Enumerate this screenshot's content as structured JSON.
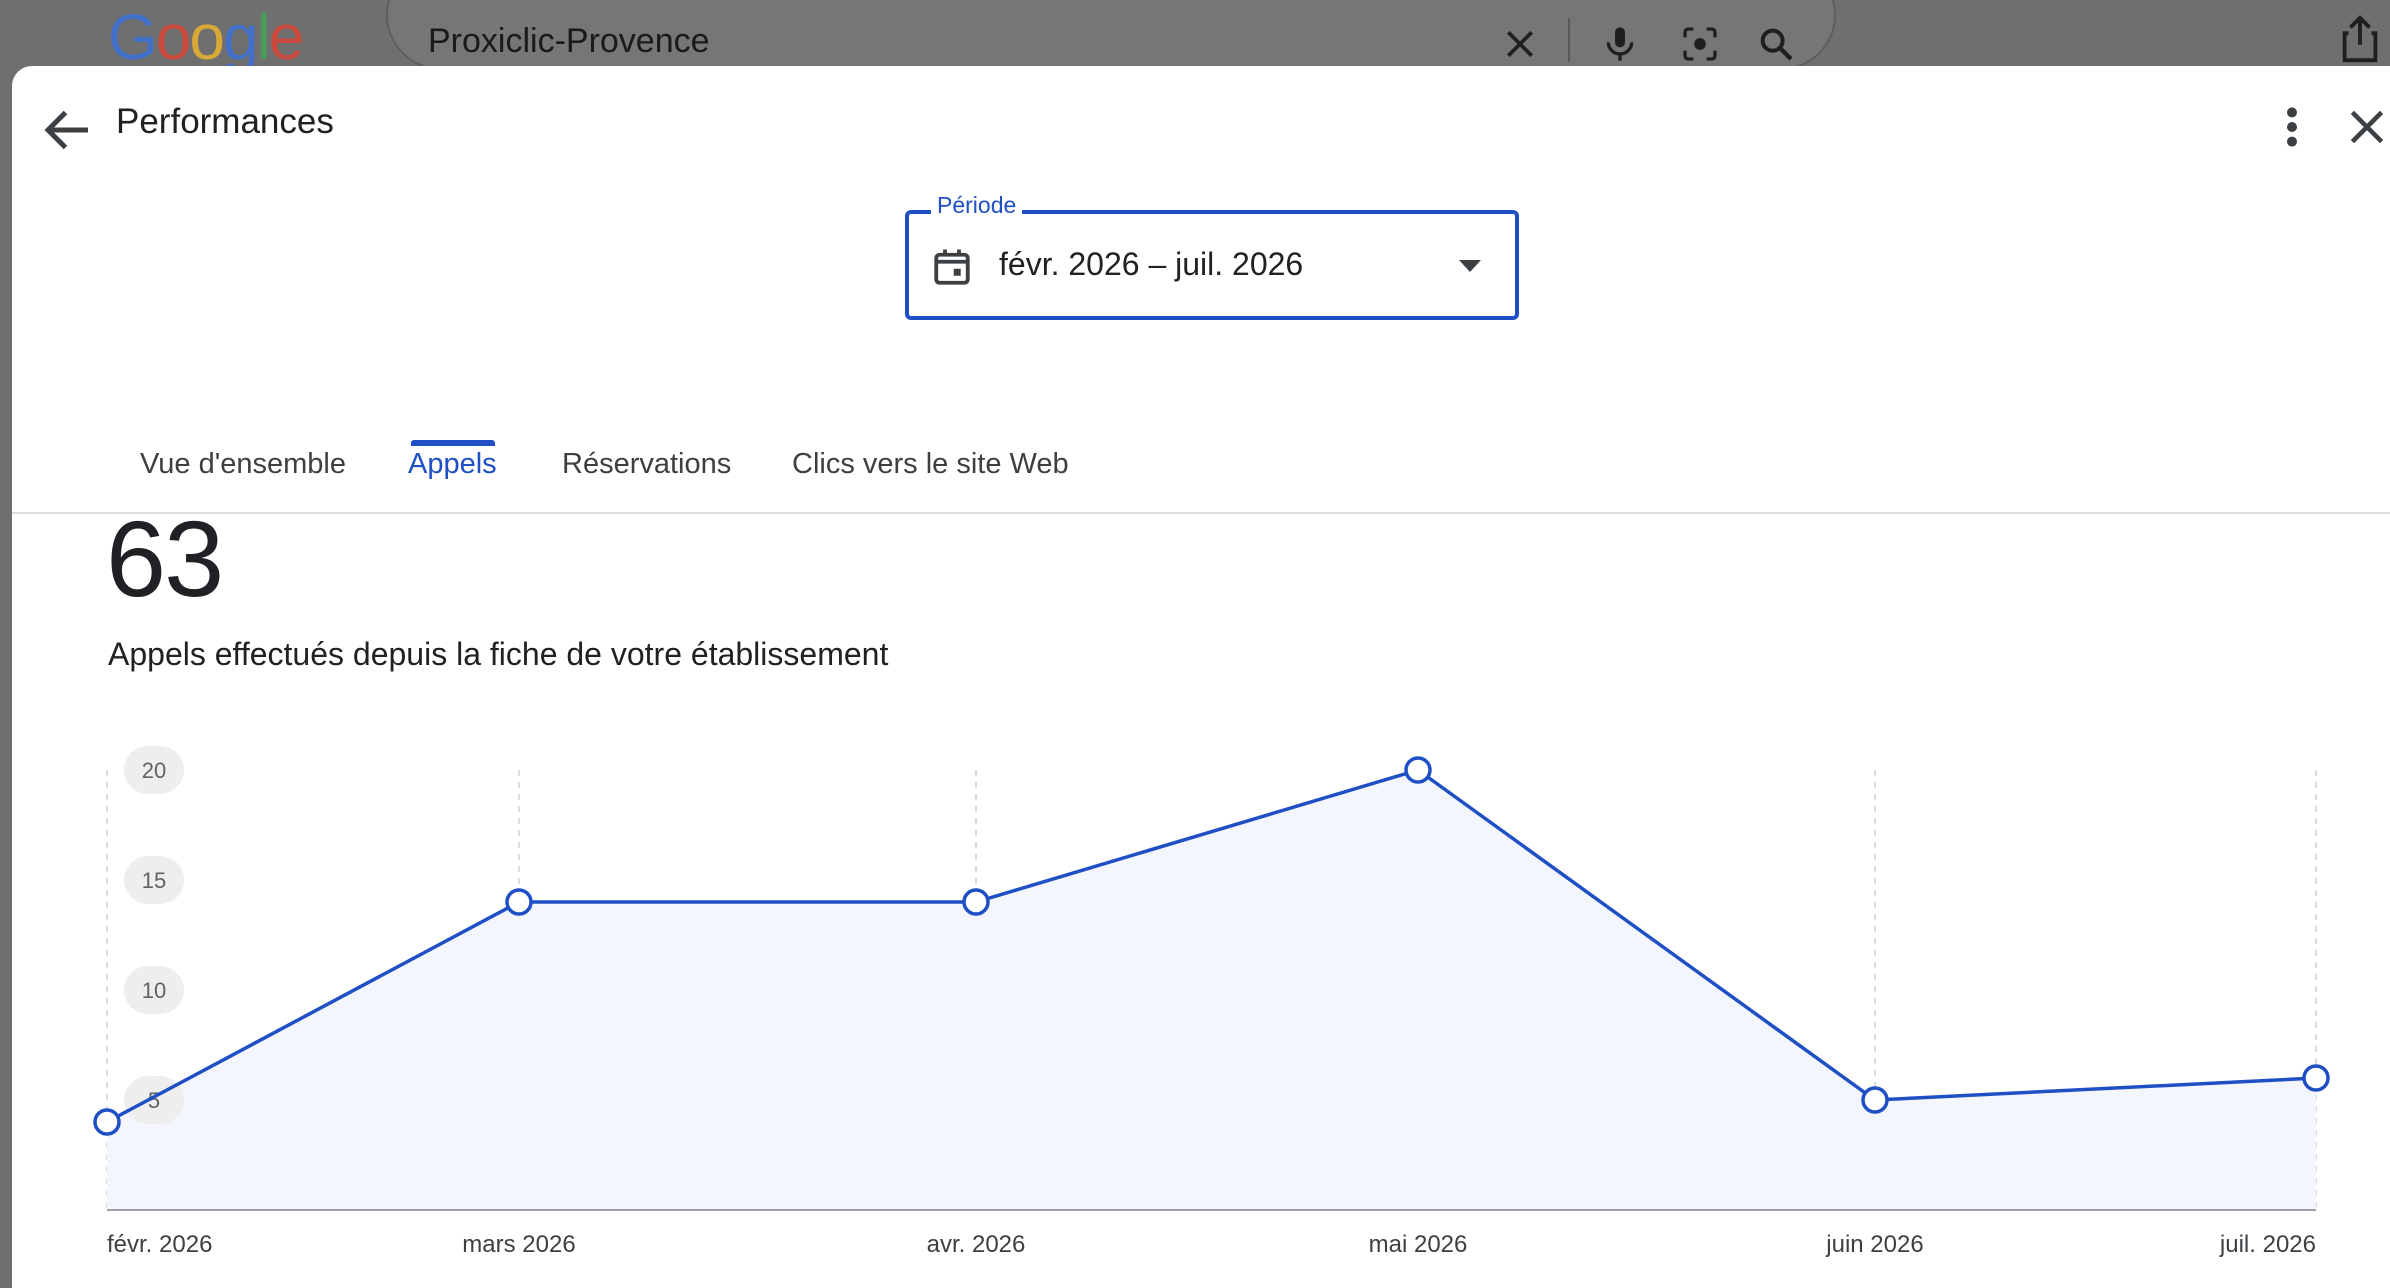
{
  "browser": {
    "logo_text": "Google",
    "search_query": "Proxiclic-Provence",
    "icons": [
      "clear-icon",
      "mic-icon",
      "lens-icon",
      "search-icon",
      "share-icon"
    ]
  },
  "dialog": {
    "title": "Performances",
    "back_icon": "arrow-back-icon",
    "more_icon": "more-vert-icon",
    "close_icon": "close-icon"
  },
  "period": {
    "label": "Période",
    "value": "févr. 2026 – juil. 2026",
    "icon": "calendar-icon"
  },
  "tabs": [
    {
      "label": "Vue d'ensemble",
      "active": false
    },
    {
      "label": "Appels",
      "active": true
    },
    {
      "label": "Réservations",
      "active": false
    },
    {
      "label": "Clics vers le site Web",
      "active": false
    }
  ],
  "summary": {
    "total": "63",
    "description": "Appels effectués depuis la fiche de votre établissement"
  },
  "colors": {
    "accent": "#1f4fc4",
    "area_fill": "#f3f6fc"
  },
  "chart_data": {
    "type": "line",
    "categories": [
      "févr. 2026",
      "mars 2026",
      "avr. 2026",
      "mai 2026",
      "juin 2026",
      "juil. 2026"
    ],
    "series": [
      {
        "values": [
          4,
          14,
          14,
          20,
          5,
          6
        ]
      }
    ],
    "yticks": [
      "5",
      "10",
      "15",
      "20"
    ],
    "ylim": [
      0,
      20
    ],
    "area_fill": true,
    "grid": "vertical dashed"
  }
}
